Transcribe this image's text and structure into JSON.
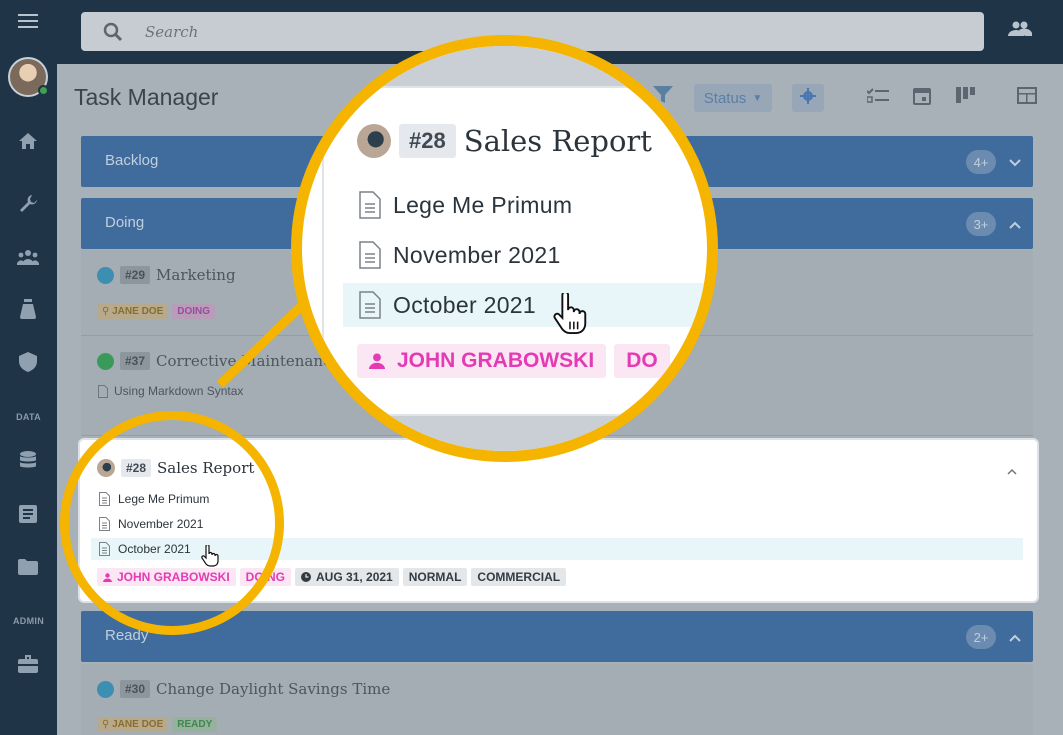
{
  "app": {
    "title": "Task Manager"
  },
  "search": {
    "placeholder": "Search"
  },
  "sidebar": {
    "section_data": "DATA",
    "section_admin": "ADMIN"
  },
  "toolbar": {
    "status_label": "Status"
  },
  "groups": [
    {
      "label": "Backlog",
      "count": "4+"
    },
    {
      "label": "Doing",
      "count": "3+"
    },
    {
      "label": "Ready",
      "count": "2+"
    }
  ],
  "tasks": {
    "t29": {
      "id": "#29",
      "name": "Marketing",
      "assignee": "JANE DOE",
      "status": "DOING"
    },
    "t37": {
      "id": "#37",
      "name": "Corrective Maintenanc",
      "doc": "Using Markdown Syntax"
    },
    "t30": {
      "id": "#30",
      "name": "Change Daylight Savings Time",
      "assignee": "JANE DOE",
      "status": "READY"
    }
  },
  "focus": {
    "id": "#28",
    "title": "Sales Report",
    "docs": [
      "Lege Me Primum",
      "November 2021",
      "October 2021"
    ],
    "assignee": "JOHN GRABOWSKI",
    "status": "DOING",
    "status_clipped": "DO",
    "due": "AUG 31, 2021",
    "priority": "NORMAL",
    "category": "COMMERCIAL"
  },
  "colors": {
    "accent": "#f4b400",
    "group": "#3f6c9c",
    "tag_pink": "#e43bb4"
  }
}
